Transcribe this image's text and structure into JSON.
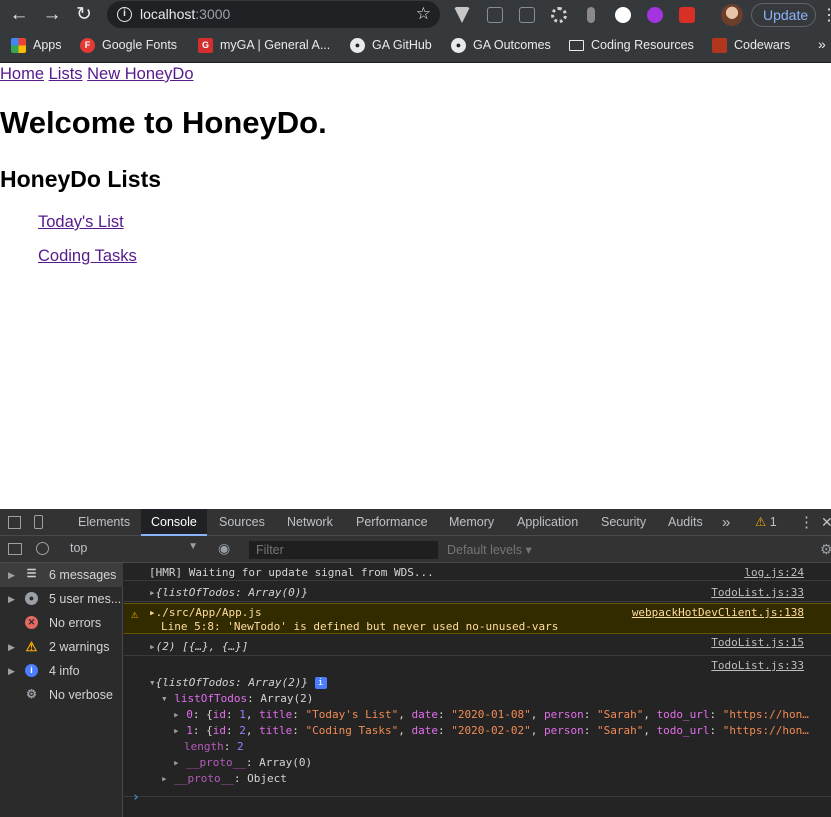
{
  "browser": {
    "url_host": "localhost",
    "url_port": ":3000",
    "update_label": "Update",
    "bookmarks": [
      {
        "label": "Apps",
        "icon": "apps-grid-icon"
      },
      {
        "label": "Google Fonts",
        "icon": "google-fonts-icon"
      },
      {
        "label": "myGA | General A...",
        "icon": "ga-icon"
      },
      {
        "label": "GA GitHub",
        "icon": "github-icon"
      },
      {
        "label": "GA Outcomes",
        "icon": "github-icon"
      },
      {
        "label": "Coding Resources",
        "icon": "folder-icon"
      },
      {
        "label": "Codewars",
        "icon": "codewars-icon"
      }
    ],
    "more_bookmarks": "»"
  },
  "page": {
    "nav": [
      "Home",
      "Lists",
      "New HoneyDo"
    ],
    "welcome": "Welcome to HoneyDo.",
    "lists_heading": "HoneyDo Lists",
    "lists": [
      "Today's List",
      "Coding Tasks"
    ]
  },
  "devtools": {
    "tabs": [
      "Elements",
      "Console",
      "Sources",
      "Network",
      "Performance",
      "Memory",
      "Application",
      "Security",
      "Audits"
    ],
    "active_tab": "Console",
    "warning_count": "1",
    "context": "top",
    "filter_placeholder": "Filter",
    "levels": "Default levels ▾",
    "sidebar": [
      {
        "label": "6 messages",
        "icon": "list-icon"
      },
      {
        "label": "5 user mes...",
        "icon": "user-icon"
      },
      {
        "label": "No errors",
        "icon": "error-icon"
      },
      {
        "label": "2 warnings",
        "icon": "warning-icon"
      },
      {
        "label": "4 info",
        "icon": "info-icon"
      },
      {
        "label": "No verbose",
        "icon": "bug-icon"
      }
    ],
    "console": {
      "line1": {
        "text": "[HMR] Waiting for update signal from WDS...",
        "source": "log.js:24"
      },
      "line2": {
        "text_key": "{listOfTodos",
        "text_val": ": Array(0)}",
        "source": "TodoList.js:33"
      },
      "line3": {
        "path": "./src/App/App.js",
        "detail": "Line 5:8:  'NewTodo' is defined but never used  no-unused-vars",
        "source": "webpackHotDevClient.js:138"
      },
      "line4": {
        "text": "(2) [{…}, {…}]",
        "source": "TodoList.js:15"
      },
      "line5": {
        "text_key": "{listOfTodos",
        "text_val": ": Array(2)}",
        "source": "TodoList.js:33"
      },
      "tree": {
        "prop": "listOfTodos",
        "prop_val": ": Array(2)",
        "item0": {
          "idx": "0",
          "id": "1",
          "title": "\"Today's List\"",
          "date": "\"2020-01-08\"",
          "person": "\"Sarah\"",
          "url": "\"https://hon…"
        },
        "item1": {
          "idx": "1",
          "id": "2",
          "title": "\"Coding Tasks\"",
          "date": "\"2020-02-02\"",
          "person": "\"Sarah\"",
          "url": "\"https://hon…"
        },
        "length_key": "length",
        "length_val": "2",
        "proto1_key": "__proto__",
        "proto1_val": ": Array(0)",
        "proto2_key": "__proto__",
        "proto2_val": ": Object"
      }
    }
  }
}
